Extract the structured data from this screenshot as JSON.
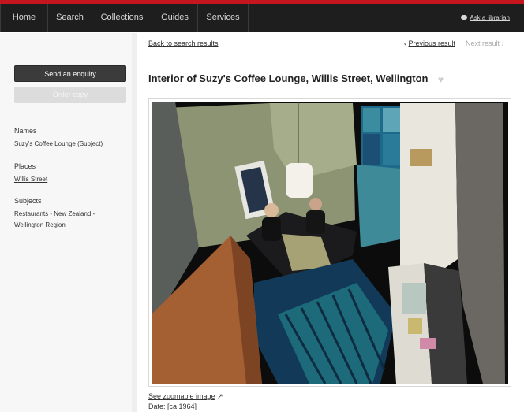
{
  "nav": {
    "items": [
      {
        "label": "Home"
      },
      {
        "label": "Search"
      },
      {
        "label": "Collections"
      },
      {
        "label": "Guides"
      },
      {
        "label": "Services"
      }
    ],
    "ask_librarian": "Ask a librarian"
  },
  "sidebar": {
    "enquiry_button": "Send an enquiry",
    "order_button": "Order copy",
    "names_label": "Names",
    "names_link": "Suzy's Coffee Lounge (Subject)",
    "places_label": "Places",
    "places_link": "Willis Street",
    "subjects_label": "Subjects",
    "subjects_link_line1": "Restaurants - New Zealand -",
    "subjects_link_line2": "Wellington Region"
  },
  "main": {
    "back_link": "Back to search results",
    "prev_label": "Previous result",
    "next_label": "Next result",
    "title": "Interior of Suzy's Coffee Lounge, Willis Street, Wellington",
    "zoom_link": "See zoomable image",
    "date_text": "Date: [ca 1964]"
  },
  "colors": {
    "accent_red": "#c4161c",
    "nav_bg": "#1e1e1e",
    "button_dark": "#3b3b3b"
  }
}
